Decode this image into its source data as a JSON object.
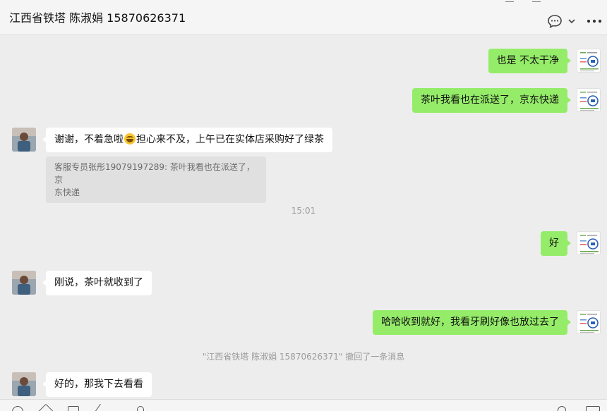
{
  "header": {
    "title": "江西省铁塔 陈淑娟 15870626371",
    "chat_icon": "chat-bubble-icon",
    "dropdown_icon": "chevron-down-icon",
    "more_icon": "more-dots-icon"
  },
  "messages": {
    "m1": {
      "text": "也是 不太干净"
    },
    "m2": {
      "text": "茶叶我看也在派送了，京东快递"
    },
    "m3": {
      "text_before": "谢谢，不着急啦",
      "emoji": "laughing-emoji-icon",
      "text_after": "担心来不及，上午已在实体店采购好了绿茶"
    },
    "m3_quote": {
      "line1": "客服专员张彤19079197289: 茶叶我看也在派送了，京",
      "line2": "东快递"
    },
    "time": "15:01",
    "m4": {
      "text": "好"
    },
    "m5": {
      "text": "刚说，茶叶就收到了"
    },
    "m6": {
      "text": "哈哈收到就好，我看牙刷好像也放过去了"
    },
    "recall": "\"江西省铁塔 陈淑娟 15870626371\" 撤回了一条消息",
    "m7": {
      "text": "好的，那我下去看看"
    }
  },
  "toolbar": {
    "icons": [
      "emoji-icon",
      "favorites-icon",
      "folder-icon",
      "screenshot-icon",
      "mic-icon",
      "phone-icon",
      "video-icon"
    ]
  },
  "colors": {
    "sent_bubble": "#95ec69",
    "received_bubble": "#ffffff",
    "background": "#ededed"
  }
}
